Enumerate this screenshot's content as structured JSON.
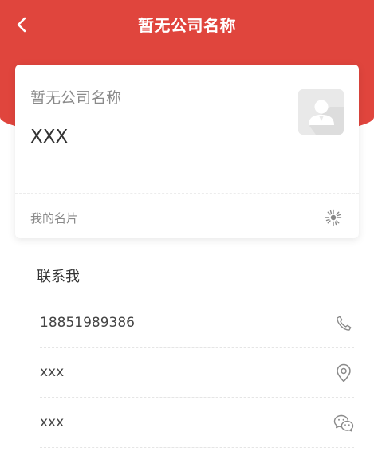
{
  "nav": {
    "title": "暂无公司名称",
    "back_icon": "chevron-left-icon"
  },
  "card": {
    "company": "暂无公司名称",
    "name": "XXX",
    "avatar_icon": "person-placeholder-icon",
    "footer_label": "我的名片",
    "qr_icon": "qr-code-icon"
  },
  "contact": {
    "title": "联系我",
    "items": [
      {
        "value": "18851989386",
        "icon": "phone-icon"
      },
      {
        "value": "xxx",
        "icon": "location-pin-icon"
      },
      {
        "value": "xxx",
        "icon": "wechat-icon"
      }
    ]
  },
  "colors": {
    "header_red": "#e0453d",
    "text_dark": "#333333",
    "text_gray": "#8a8a8a"
  }
}
